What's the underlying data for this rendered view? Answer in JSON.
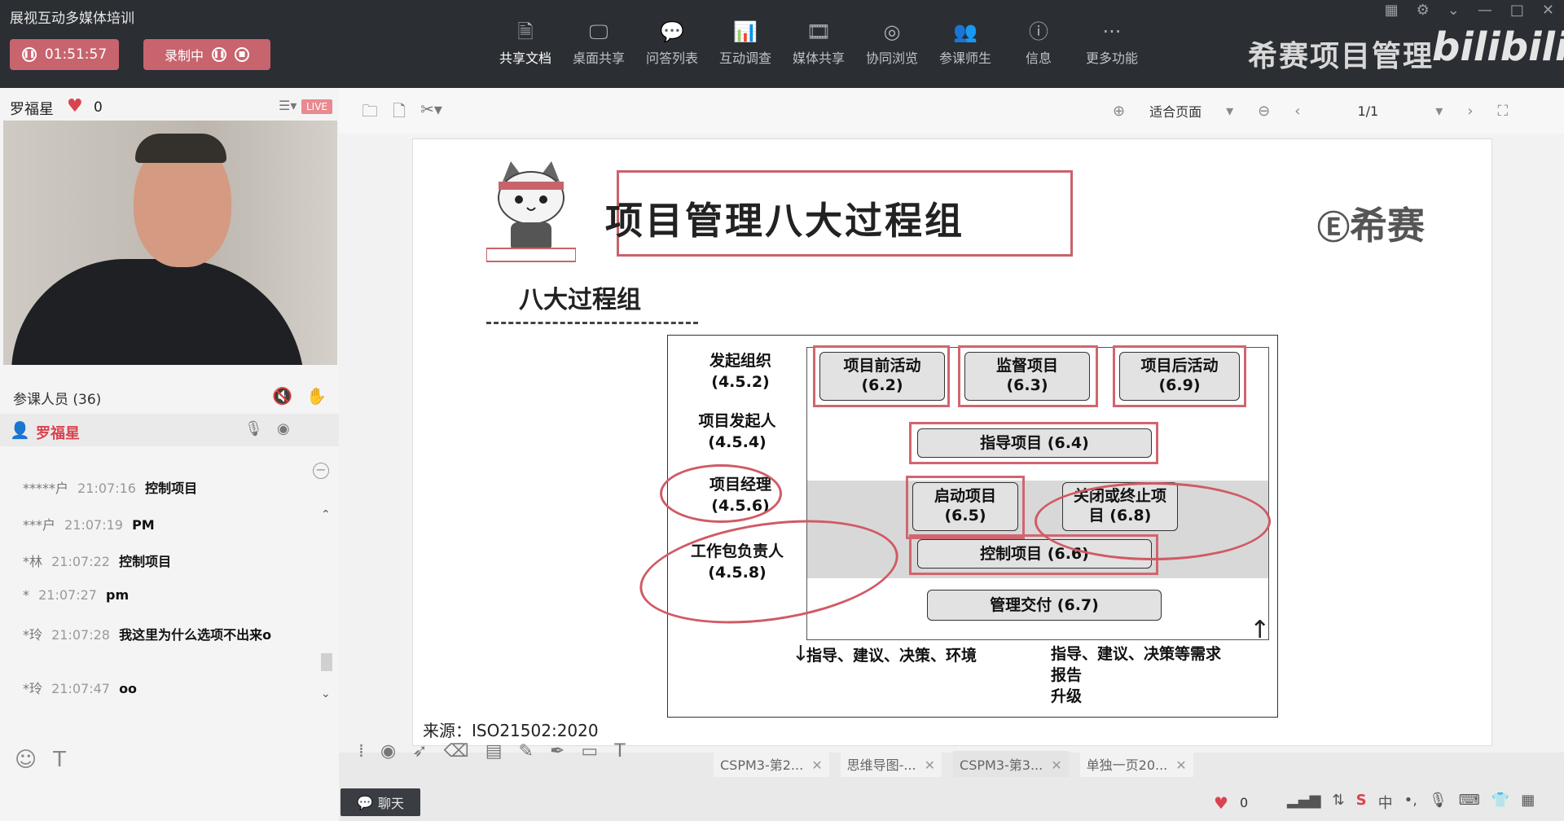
{
  "app": {
    "title": "展视互动多媒体培训"
  },
  "status": {
    "timer": "01:51:57",
    "recording_label": "录制中"
  },
  "toolbar": {
    "items": [
      {
        "label": "共享文档",
        "icon": "document-icon"
      },
      {
        "label": "桌面共享",
        "icon": "desktop-icon"
      },
      {
        "label": "问答列表",
        "icon": "qa-icon"
      },
      {
        "label": "互动调查",
        "icon": "survey-icon"
      },
      {
        "label": "媒体共享",
        "icon": "media-icon"
      },
      {
        "label": "协同浏览",
        "icon": "browse-icon"
      },
      {
        "label": "参课师生",
        "icon": "people-icon"
      },
      {
        "label": "信息",
        "icon": "info-icon"
      },
      {
        "label": "更多功能",
        "icon": "more-icon"
      }
    ]
  },
  "brand": {
    "name": "希赛项目管理",
    "logo_text": "bilibili"
  },
  "presenter": {
    "name": "罗福星",
    "likes": "0",
    "live_badge": "LIVE"
  },
  "participants": {
    "label": "参课人员 (36)",
    "current_user": "罗福星"
  },
  "chat": {
    "messages": [
      {
        "name": "*****户",
        "time": "21:07:16",
        "text": "控制项目"
      },
      {
        "name": "***户",
        "time": "21:07:19",
        "text": "PM"
      },
      {
        "name": "*林",
        "time": "21:07:22",
        "text": "控制项目"
      },
      {
        "name": "*",
        "time": "21:07:27",
        "text": "pm"
      },
      {
        "name": "*玲",
        "time": "21:07:28",
        "text": "我这里为什么选项不出来o"
      },
      {
        "name": "*玲",
        "time": "21:07:47",
        "text": "oo"
      }
    ],
    "chat_button": "聊天"
  },
  "doc_toolbar": {
    "zoom_mode": "适合页面",
    "page": "1/1"
  },
  "slide": {
    "title": "项目管理八大过程组",
    "subtitle": "八大过程组",
    "logo": "希赛",
    "roles": [
      {
        "name": "发起组织",
        "code": "(4.5.2)"
      },
      {
        "name": "项目发起人",
        "code": "(4.5.4)"
      },
      {
        "name": "项目经理",
        "code": "(4.5.6)"
      },
      {
        "name": "工作包负责人",
        "code": "(4.5.8)"
      }
    ],
    "processes": [
      {
        "name": "项目前活动",
        "code": "(6.2)"
      },
      {
        "name": "监督项目",
        "code": "(6.3)"
      },
      {
        "name": "项目后活动",
        "code": "(6.9)"
      },
      {
        "name": "指导项目 (6.4)",
        "code": ""
      },
      {
        "name": "启动项目",
        "code": "(6.5)"
      },
      {
        "name": "关闭或终止项",
        "code": "目 (6.8)"
      },
      {
        "name": "控制项目 (6.6)",
        "code": ""
      },
      {
        "name": "管理交付 (6.7)",
        "code": ""
      }
    ],
    "down_caption": "指导、建议、决策、环境",
    "up_caption_1": "指导、建议、决策等需求",
    "up_caption_2": "报告",
    "up_caption_3": "升级",
    "source": "来源：ISO21502:2020"
  },
  "tabs": [
    {
      "label": "CSPM3-第2..."
    },
    {
      "label": "思维导图-..."
    },
    {
      "label": "CSPM3-第3..."
    },
    {
      "label": "单独一页20..."
    }
  ],
  "bottom": {
    "likes": "0"
  },
  "colors": {
    "accent": "#c8646e",
    "ink": "#d05a65",
    "topbar": "#2b2e33"
  }
}
